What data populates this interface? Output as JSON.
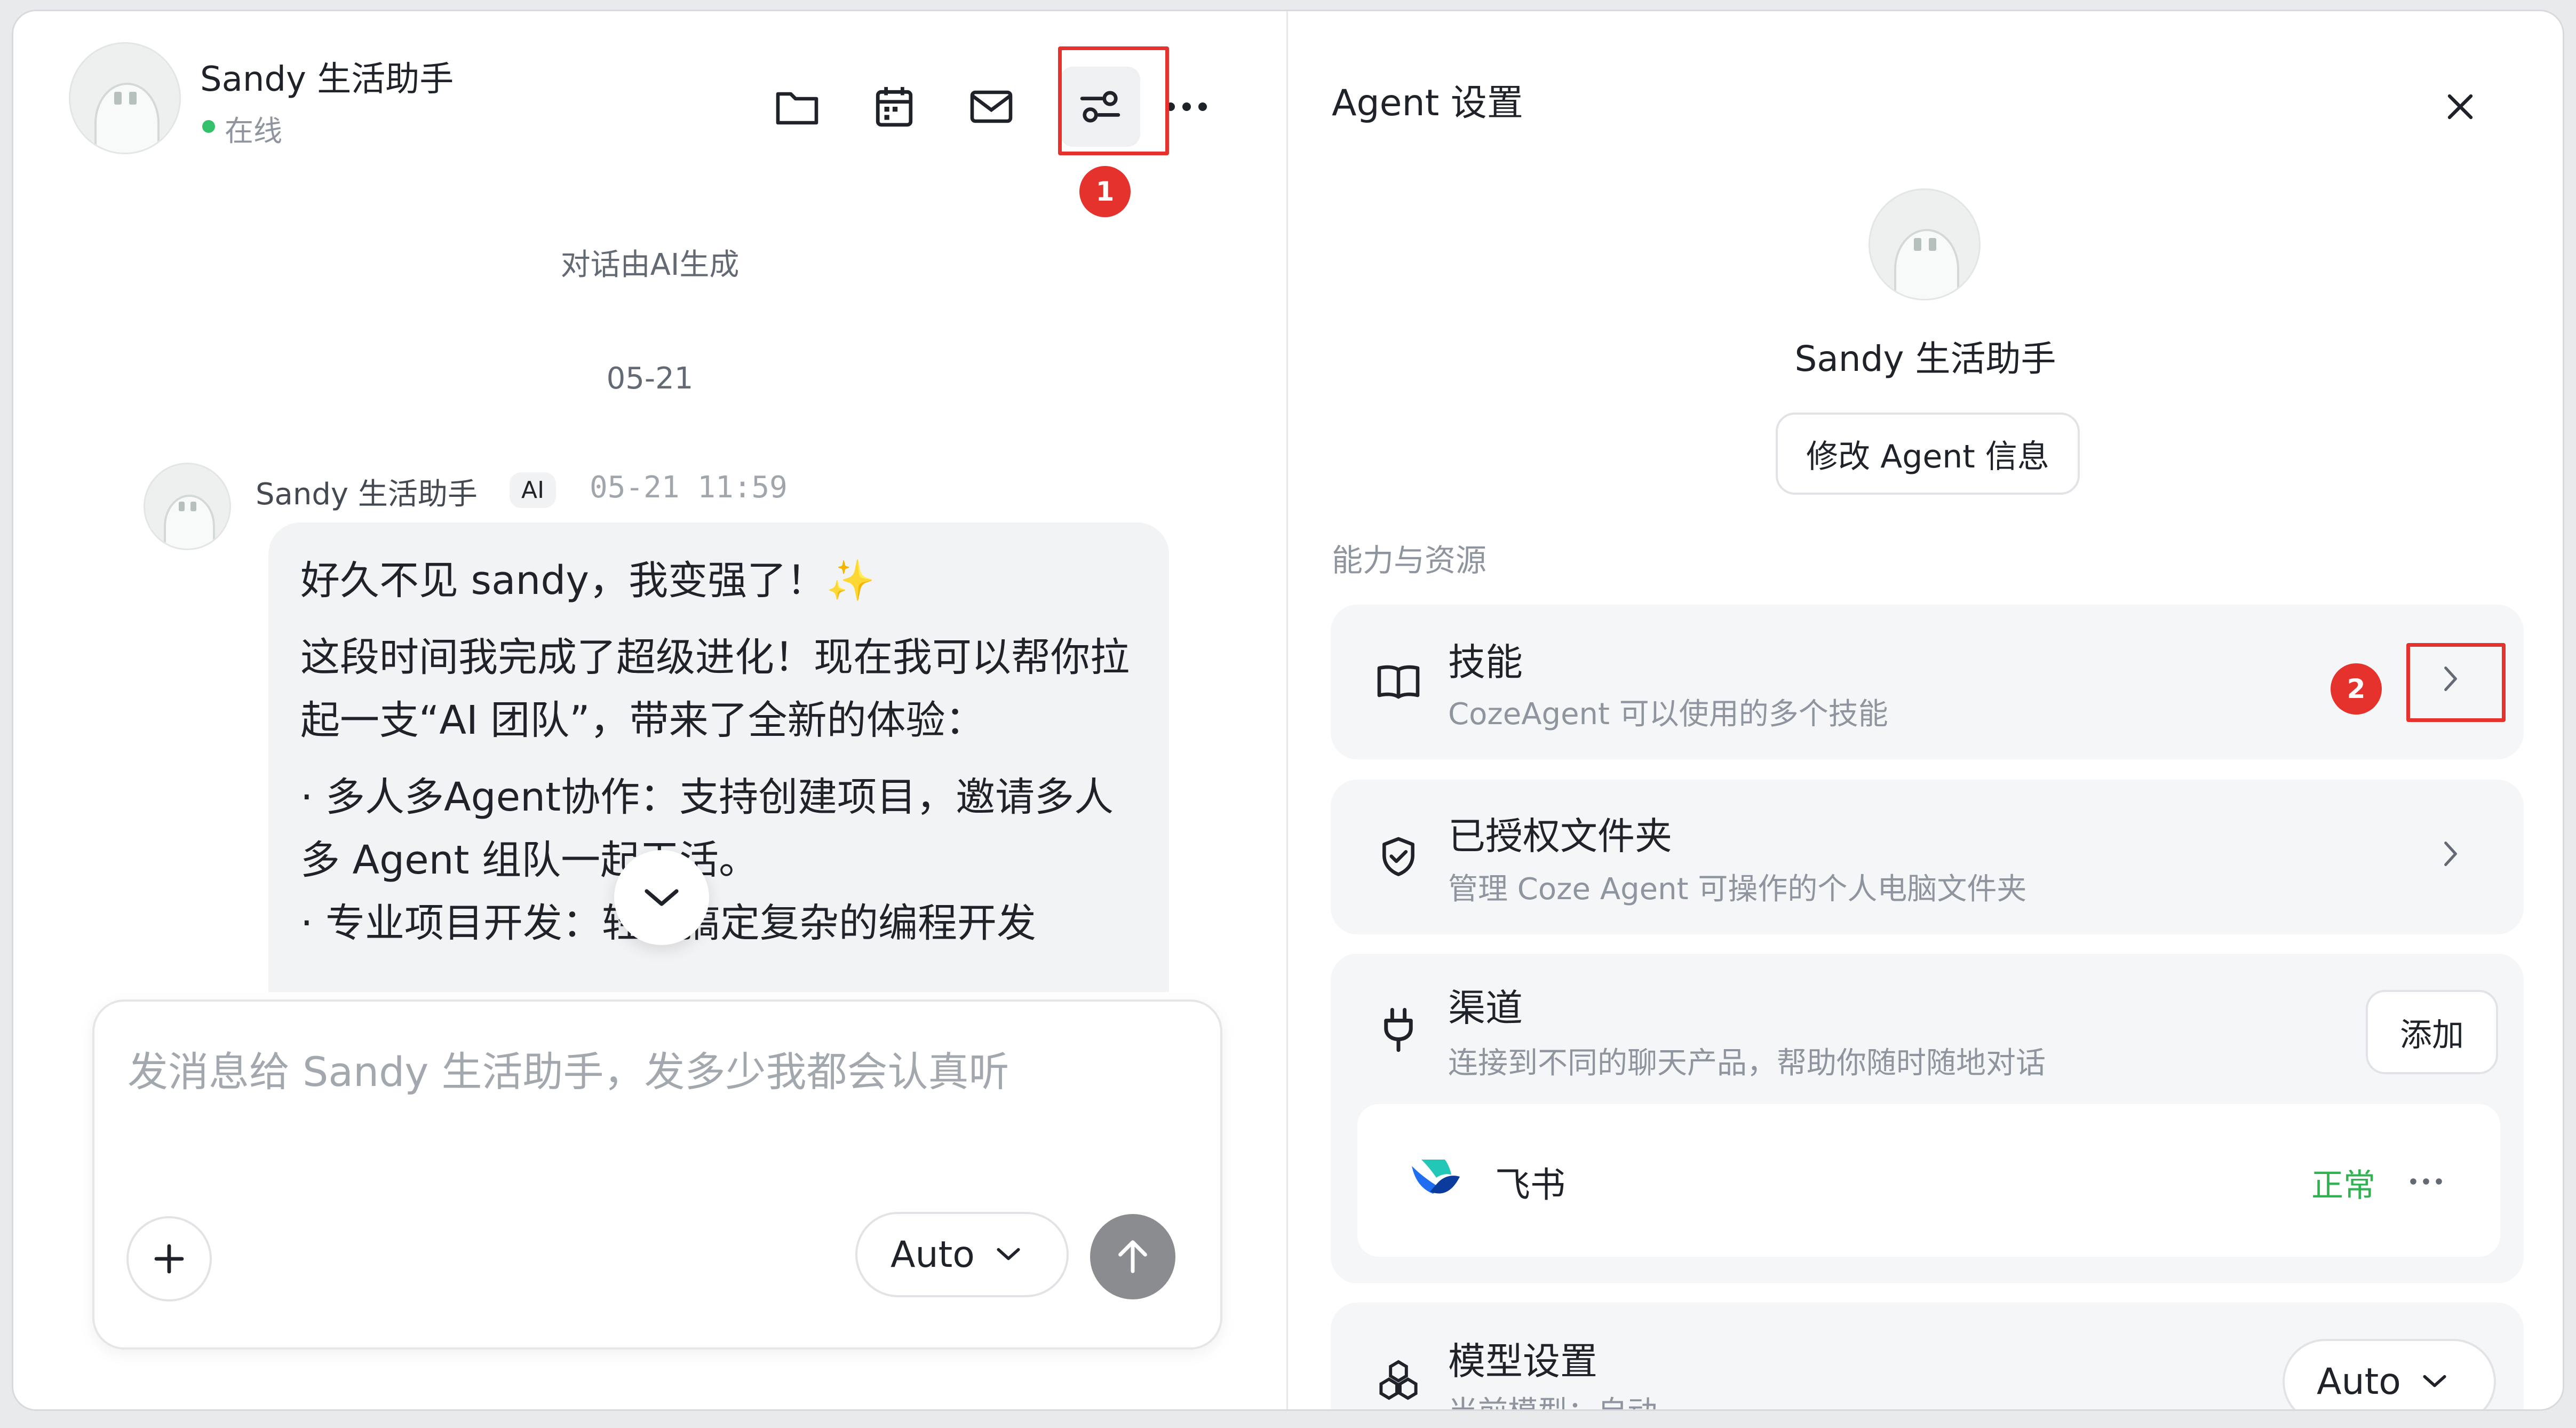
{
  "chat": {
    "agent_name": "Sandy 生活助手",
    "status": "在线",
    "toolbar": {
      "files_icon": "folder-icon",
      "calendar_icon": "calendar-icon",
      "mail_icon": "mail-icon",
      "settings_icon": "sliders-icon",
      "more_icon": "more-horizontal-icon"
    },
    "annotations": {
      "badge1": "1",
      "badge2": "2",
      "color": "#e5322d"
    },
    "ai_generated_note": "对话由AI生成",
    "date_divider": "05-21",
    "message": {
      "sender": "Sandy 生活助手",
      "tag": "AI",
      "time": "05-21 11:59",
      "lines": [
        "好久不见 sandy，我变强了！✨",
        "这段时间我完成了超级进化！现在我可以帮你拉起一支“AI 团队”，带来了全新的体验：",
        "· 多人多Agent协作：支持创建项目，邀请多人多 Agent 组队一起干活。",
        "· 专业项目开发：轻松搞定复杂的编程开发"
      ]
    },
    "composer": {
      "placeholder": "发消息给 Sandy 生活助手，发多少我都会认真听",
      "model_select": "Auto"
    }
  },
  "settings": {
    "title": "Agent 设置",
    "agent_name": "Sandy 生活助手",
    "edit_button": "修改 Agent 信息",
    "section_label": "能力与资源",
    "skills": {
      "title": "技能",
      "desc": "CozeAgent 可以使用的多个技能"
    },
    "folders": {
      "title": "已授权文件夹",
      "desc": "管理 Coze Agent 可操作的个人电脑文件夹"
    },
    "channels": {
      "title": "渠道",
      "desc": "连接到不同的聊天产品，帮助你随时随地对话",
      "add_button": "添加",
      "items": [
        {
          "name": "飞书",
          "status": "正常",
          "status_color": "#2fb24f"
        }
      ]
    },
    "model": {
      "title": "模型设置",
      "desc": "当前模型：自动",
      "select": "Auto"
    }
  }
}
